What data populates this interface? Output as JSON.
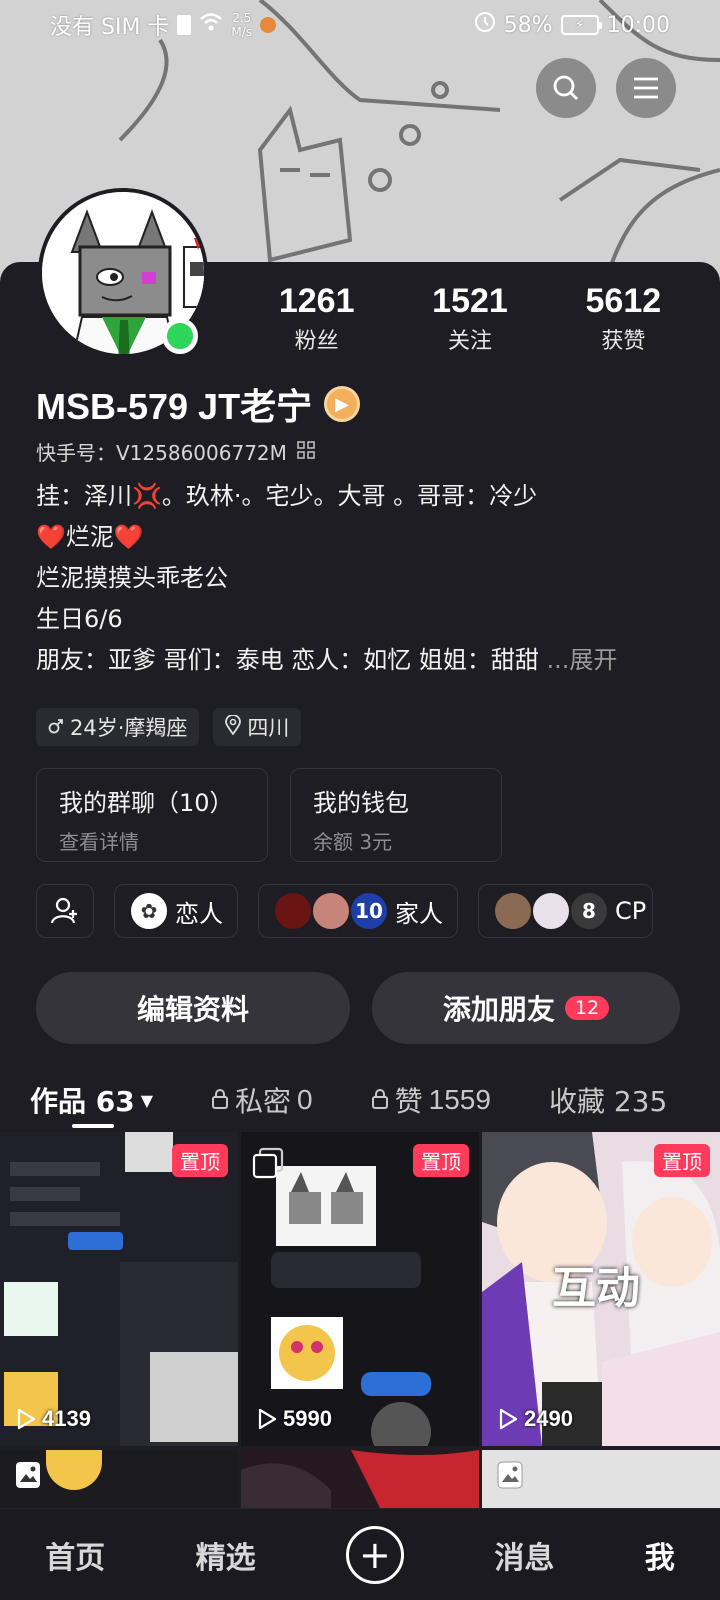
{
  "status_bar": {
    "carrier": "没有 SIM 卡",
    "net_speed_value": "2.5",
    "net_speed_unit": "M/s",
    "battery_percent": "58%",
    "time": "10:00"
  },
  "profile": {
    "stats": [
      {
        "num": "1261",
        "label": "粉丝"
      },
      {
        "num": "1521",
        "label": "关注"
      },
      {
        "num": "5612",
        "label": "获赞"
      }
    ],
    "name": "MSB-579 JT老宁",
    "kuaishou_id": "快手号：V12586006772M",
    "bio": {
      "line1": "挂：泽川💢。玖林·。宅少。大哥 。哥哥：冷少",
      "line2": "❤️烂泥❤️",
      "line3": "烂泥摸摸头乖老公",
      "line4": "生日6/6",
      "line5": "朋友：亚爹 哥们：泰电 恋人：如忆 姐姐：甜甜",
      "expand": "...展开"
    },
    "tags": {
      "age": "24岁·摩羯座",
      "location": "四川"
    }
  },
  "cards": {
    "group_title": "我的群聊（10）",
    "group_sub": "查看详情",
    "wallet_title": "我的钱包",
    "wallet_sub": "余额 3元"
  },
  "relations": {
    "lover": "恋人",
    "family_count": "10",
    "family": "家人",
    "cp_count": "8",
    "cp": "CP"
  },
  "actions": {
    "edit": "编辑资料",
    "add_friend": "添加朋友",
    "add_friend_count": "12"
  },
  "tabs": {
    "works": "作品 63",
    "private_label": "私密",
    "private_count": "0",
    "likes_label": "赞",
    "likes_count": "1559",
    "favorites": "收藏 235"
  },
  "videos": [
    {
      "pin": "置顶",
      "plays": "4139"
    },
    {
      "pin": "置顶",
      "plays": "5990"
    },
    {
      "pin": "置顶",
      "plays": "2490",
      "overlay": "互动"
    }
  ],
  "nav": {
    "home": "首页",
    "featured": "精选",
    "messages": "消息",
    "me": "我"
  },
  "colors": {
    "accent": "#ff3b5c",
    "online": "#2fd45a",
    "panel": "#1d1d23"
  }
}
